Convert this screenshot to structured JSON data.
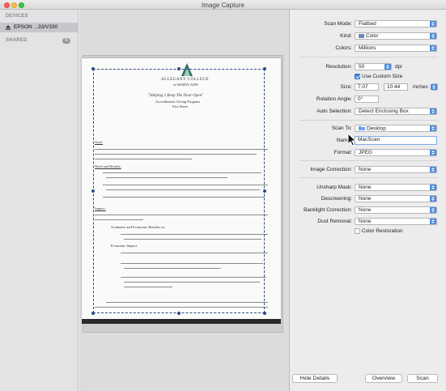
{
  "window": {
    "title": "Image Capture"
  },
  "sidebar": {
    "devices_header": "DEVICES",
    "device_name": "EPSON ...33/V330",
    "shared_header": "SHARED",
    "shared_count": "0"
  },
  "document": {
    "college": "ALLEGANY COLLEGE",
    "college_sub": "of MARYLAND",
    "heading1": "\"Helping 2 Keep The Door Open\"",
    "heading2": "Accreditation Giving Program",
    "heading3": "Fact Sheet",
    "sec_goal": "Goal:",
    "sec_need": "Need and Results:",
    "sec_impact": "Impact:",
    "sub_grad": "Graduates and Economic Benefits to:",
    "sub_econ": "Economic Impact:"
  },
  "settings": {
    "scan_mode": {
      "label": "Scan Mode:",
      "value": "Flatbed"
    },
    "kind": {
      "label": "Kind:",
      "value": "Color",
      "swatch_color": "#5b8fd6"
    },
    "colors": {
      "label": "Colors:",
      "value": "Millions"
    },
    "resolution": {
      "label": "Resolution:",
      "value": "50",
      "unit": "dpi"
    },
    "custom_size": {
      "label": "Use Custom Size",
      "checked": true
    },
    "size": {
      "label": "Size:",
      "width": "7.07",
      "height": "10.44",
      "unit": "inches"
    },
    "rotation": {
      "label": "Rotation Angle:",
      "value": "0°"
    },
    "auto_selection": {
      "label": "Auto Selection:",
      "value": "Detect Enclosing Box"
    },
    "scan_to": {
      "label": "Scan To:",
      "value": "Desktop"
    },
    "name": {
      "label": "Name:",
      "value": "MacScan"
    },
    "format": {
      "label": "Format:",
      "value": "JPEG"
    },
    "image_correction": {
      "label": "Image Correction:",
      "value": "None"
    },
    "unsharp_mask": {
      "label": "Unsharp Mask:",
      "value": "None"
    },
    "descreening": {
      "label": "Descreening:",
      "value": "None"
    },
    "backlight": {
      "label": "Backlight Correction:",
      "value": "None"
    },
    "dust_removal": {
      "label": "Dust Removal:",
      "value": "None"
    },
    "color_restoration": {
      "label": "Color Restoration",
      "checked": false
    }
  },
  "buttons": {
    "hide_details": "Hide Details",
    "overview": "Overview",
    "scan": "Scan"
  },
  "colors": {
    "accent": "#3d82e3",
    "sidebar_bg": "#e4e2e4",
    "panel_bg": "#ececec"
  }
}
